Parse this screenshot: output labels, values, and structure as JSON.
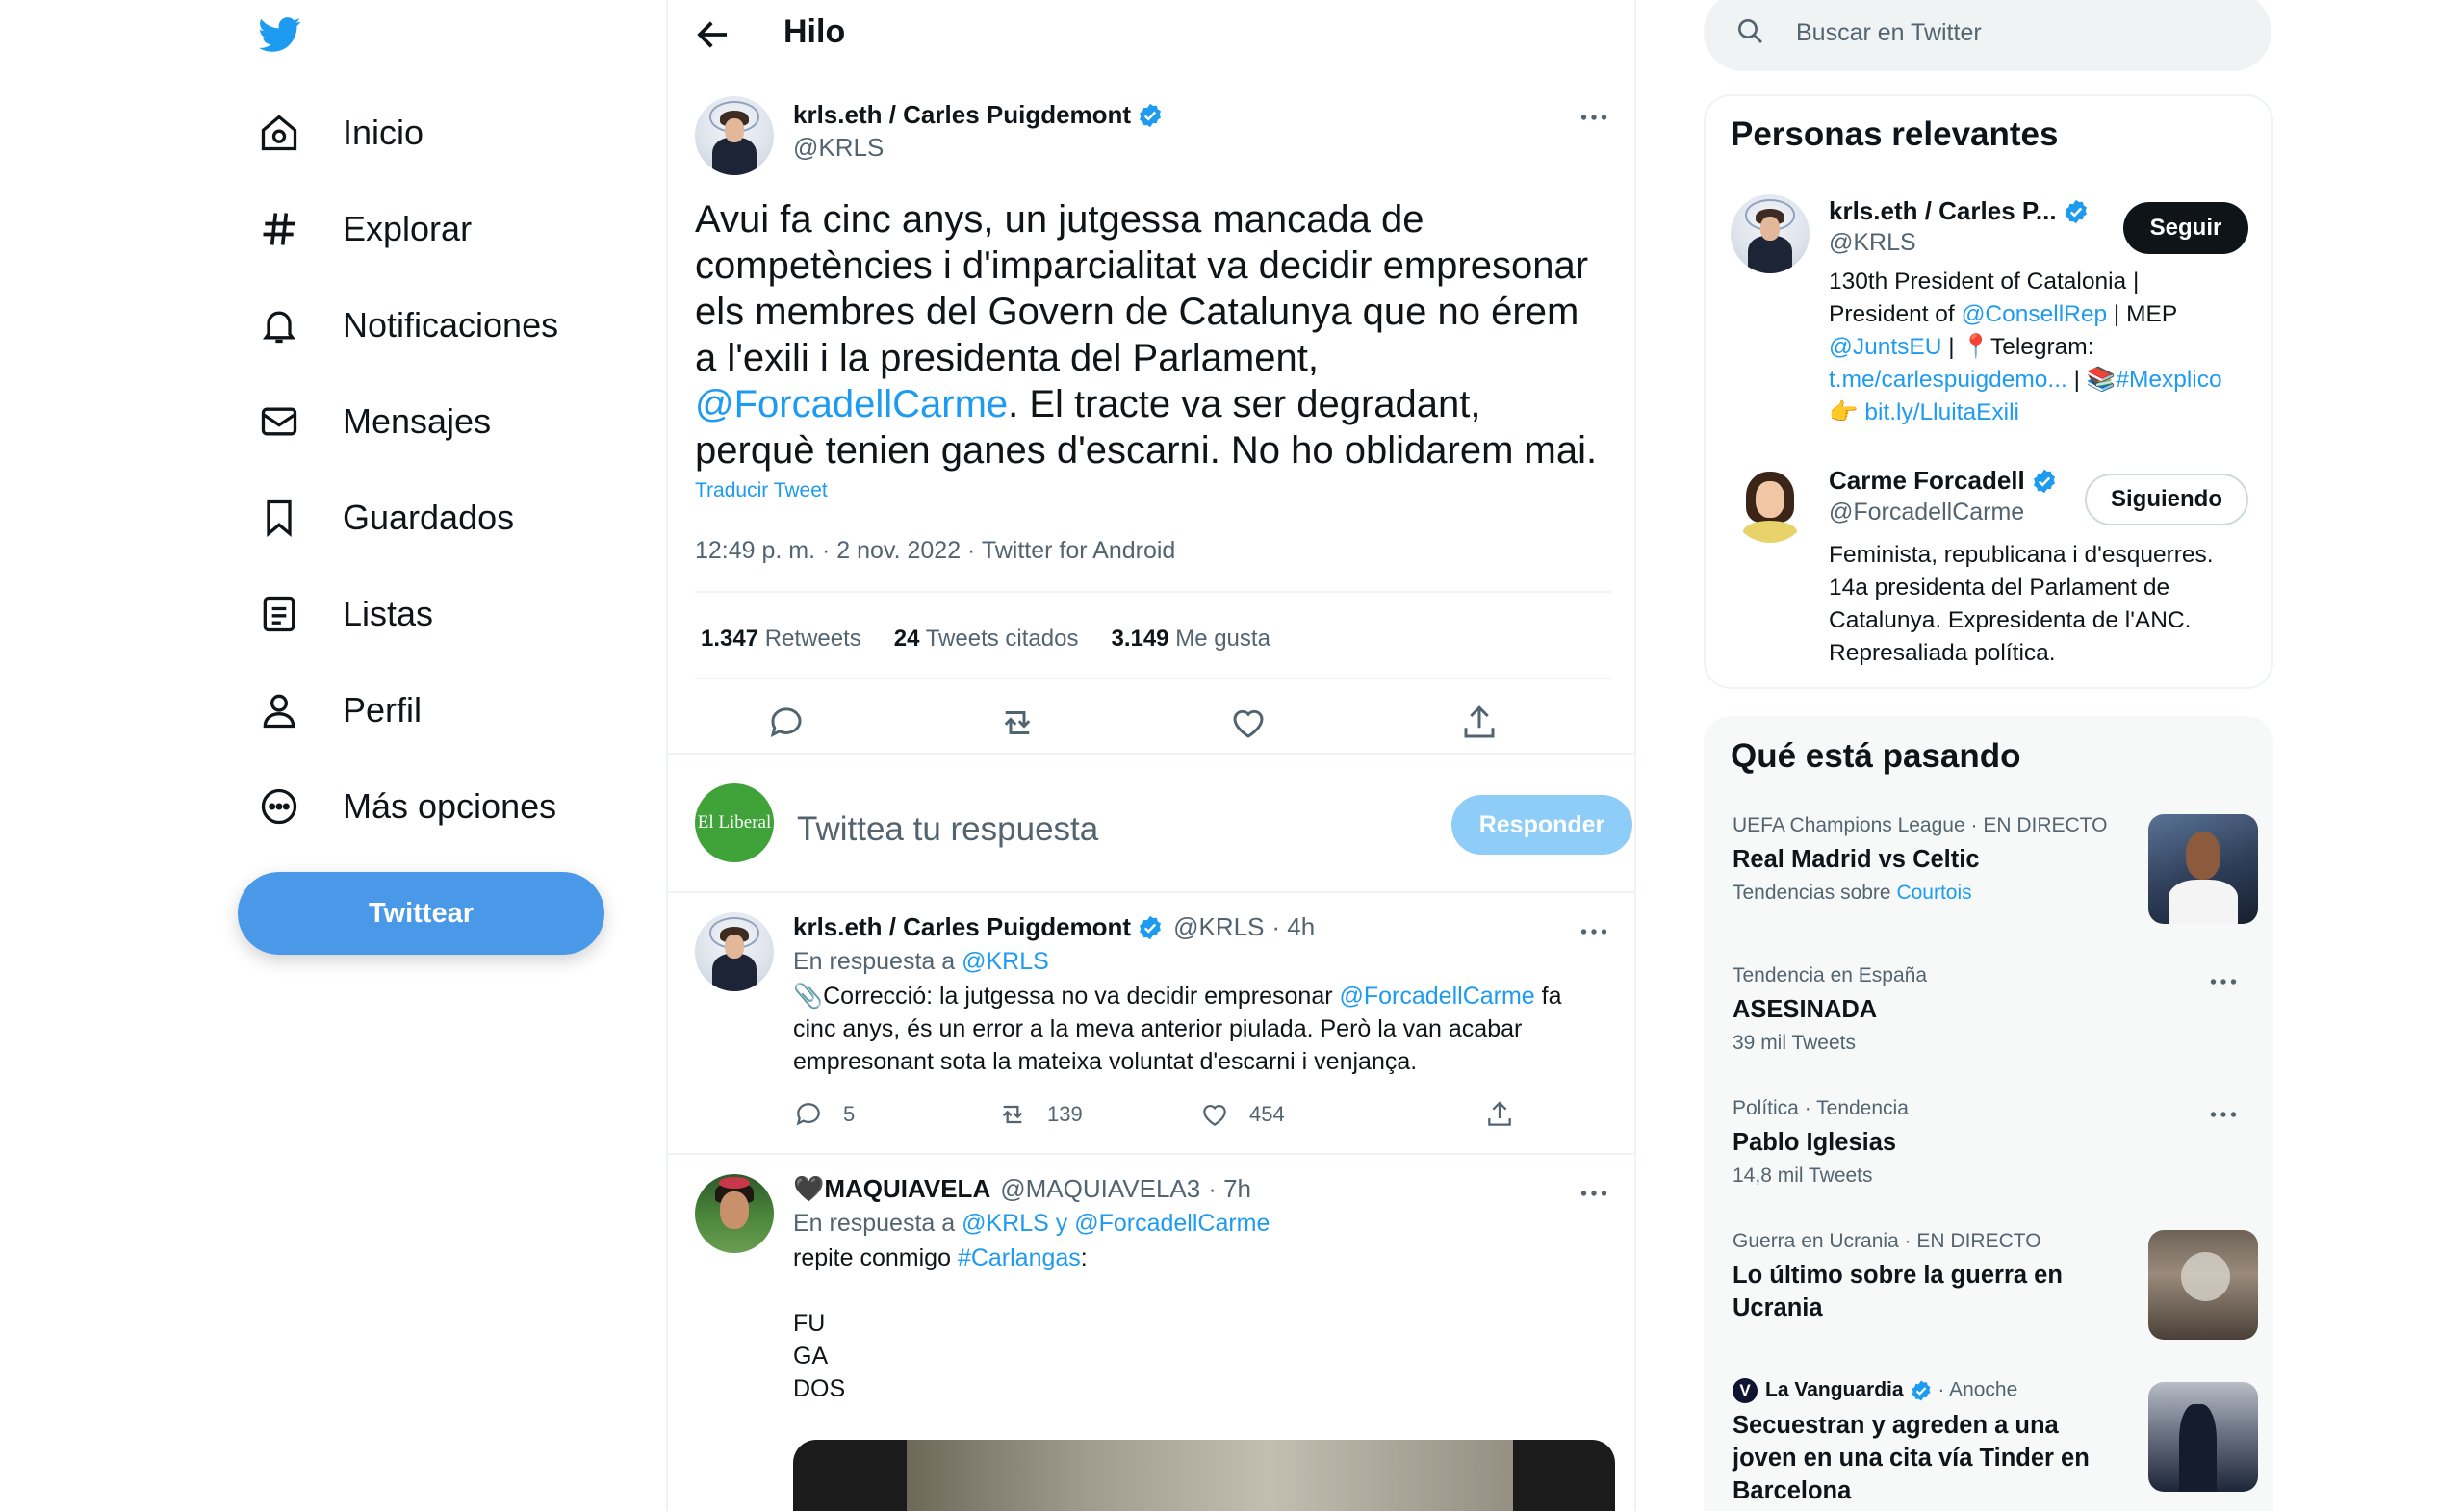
{
  "nav": {
    "items": [
      {
        "label": "Inicio",
        "icon": "home-icon"
      },
      {
        "label": "Explorar",
        "icon": "hashtag-icon"
      },
      {
        "label": "Notificaciones",
        "icon": "bell-icon"
      },
      {
        "label": "Mensajes",
        "icon": "mail-icon"
      },
      {
        "label": "Guardados",
        "icon": "bookmark-icon"
      },
      {
        "label": "Listas",
        "icon": "list-icon"
      },
      {
        "label": "Perfil",
        "icon": "person-icon"
      },
      {
        "label": "Más opciones",
        "icon": "more-circle-icon"
      }
    ],
    "tweet_button": "Twittear"
  },
  "header": {
    "title": "Hilo"
  },
  "main_tweet": {
    "name": "krls.eth / Carles Puigdemont",
    "handle": "@KRLS",
    "text_before": "Avui fa cinc anys, un jutgessa mancada de competències i d'imparcialitat va decidir empresonar els membres del Govern de Catalunya que no érem a l'exili i la presidenta del Parlament, ",
    "mention": "@ForcadellCarme",
    "text_after": ". El tracte va ser degradant, perquè tenien ganes d'escarni. No ho oblidarem mai.",
    "translate": "Traducir Tweet",
    "meta": "12:49 p. m. · 2 nov. 2022 · Twitter for Android",
    "stats": {
      "retweets_num": "1.347",
      "retweets_label": "Retweets",
      "quotes_num": "24",
      "quotes_label": "Tweets citados",
      "likes_num": "3.149",
      "likes_label": "Me gusta"
    }
  },
  "reply_box": {
    "avatar_text": "El Liberal",
    "placeholder": "Twittea tu respuesta",
    "button": "Responder"
  },
  "replies": [
    {
      "name": "krls.eth / Carles Puigdemont",
      "handle": "@KRLS",
      "time": "· 4h",
      "reply_to_label": "En respuesta a",
      "reply_to": "@KRLS",
      "text_1": "📎Correcció: la jutgessa no va decidir empresonar ",
      "mention": "@ForcadellCarme",
      "text_2": " fa",
      "text_3": "cinc anys, és un error a la meva anterior piulada. Però la van acabar",
      "text_4": "empresonant sota la mateixa voluntat d'escarni i venjança.",
      "replies_count": "5",
      "retweets_count": "139",
      "likes_count": "454"
    },
    {
      "name": "🖤MAQUIAVELA",
      "handle": "@MAQUIAVELA3",
      "time": "· 7h",
      "reply_to_label": "En respuesta a",
      "reply_to": "@KRLS y @ForcadellCarme",
      "text_1": "repite conmigo ",
      "hashtag": "#Carlangas",
      "text_colon": ":",
      "line_1": "FU",
      "line_2": "GA",
      "line_3": "DOS"
    }
  ],
  "search": {
    "placeholder": "Buscar en Twitter"
  },
  "relevant": {
    "title": "Personas relevantes",
    "people": [
      {
        "name": "krls.eth / Carles P...",
        "handle": "@KRLS",
        "button": "Seguir",
        "bio_1": "130th President of Catalonia |",
        "bio_2a": "President of ",
        "bio_2b": "@ConsellRep",
        "bio_2c": " | MEP",
        "bio_3a": "@JuntsEU",
        "bio_3b": " | 📍Telegram:",
        "bio_4a": "t.me/carlespuigdemo...",
        "bio_4b": " | 📚",
        "bio_4c": "#Mexplico",
        "bio_5a": "👉 ",
        "bio_5b": "bit.ly/LluitaExili"
      },
      {
        "name": "Carme Forcadell",
        "handle": "@ForcadellCarme",
        "button": "Siguiendo",
        "bio_1": "Feminista, republicana i d'esquerres.",
        "bio_2": "14a presidenta del Parlament de",
        "bio_3": "Catalunya. Expresidenta de l'ANC.",
        "bio_4": "Represaliada política."
      }
    ]
  },
  "trends": {
    "title": "Qué está pasando",
    "items": [
      {
        "context": "UEFA Champions League · EN DIRECTO",
        "title": "Real Madrid vs Celtic",
        "sub_label": "Tendencias sobre",
        "sub_link": "Courtois"
      },
      {
        "context": "Tendencia en España",
        "title": "ASESINADA",
        "count": "39 mil Tweets"
      },
      {
        "context": "Política · Tendencia",
        "title": "Pablo Iglesias",
        "count": "14,8 mil Tweets"
      },
      {
        "context": "Guerra en Ucrania · EN DIRECTO",
        "title_1": "Lo último sobre la guerra en",
        "title_2": "Ucrania"
      },
      {
        "source": "La Vanguardia",
        "time": "· Anoche",
        "title_1": "Secuestran y agreden a una",
        "title_2": "joven en una cita vía Tinder en",
        "title_3": "Barcelona"
      }
    ]
  }
}
